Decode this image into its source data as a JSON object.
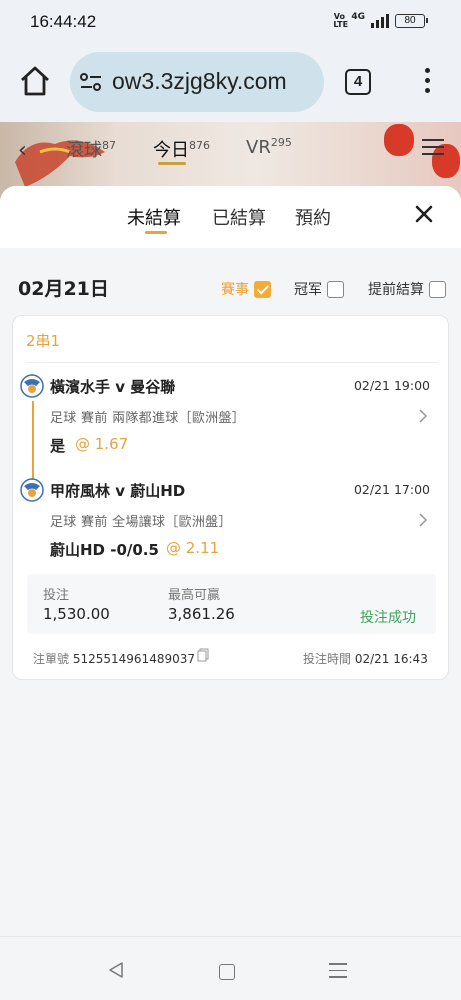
{
  "status": {
    "time": "16:44:42",
    "volte": "Vo LTE",
    "network": "4G",
    "battery": "80"
  },
  "browser": {
    "url": "ow3.3zjg8ky.com",
    "tab_count": "4"
  },
  "site_header": {
    "tabs": [
      {
        "label": "滾球",
        "count": "87"
      },
      {
        "label": "今日",
        "count": "876"
      },
      {
        "label": "VR",
        "count": "295"
      }
    ]
  },
  "sheet": {
    "tabs": [
      "未結算",
      "已結算",
      "預約"
    ],
    "active_tab": "未結算"
  },
  "filters": {
    "date": "02月21日",
    "events_label": "賽事",
    "champion_label": "冠军",
    "early_settle_label": "提前結算"
  },
  "bet": {
    "type": "2串1",
    "legs": [
      {
        "match": "橫濱水手 v 曼谷聯",
        "time": "02/21 19:00",
        "desc": "足球  賽前  兩隊都進球［歐洲盤］",
        "pick": "是",
        "odds": "@ 1.67"
      },
      {
        "match": "甲府風林 v 蔚山HD",
        "time": "02/21 17:00",
        "desc": "足球  賽前  全場讓球［歐洲盤］",
        "pick": "蔚山HD -0/0.5",
        "odds": "@ 2.11"
      }
    ],
    "stake_label": "投注",
    "stake": "1,530.00",
    "max_win_label": "最高可贏",
    "max_win": "3,861.26",
    "status": "投注成功",
    "order_label": "注單號",
    "order_no": "5125514961489037",
    "time_label": "投注時間",
    "bet_time": "02/21 16:43"
  },
  "colors": {
    "accent": "#e8a33c",
    "success": "#3ea35a"
  }
}
